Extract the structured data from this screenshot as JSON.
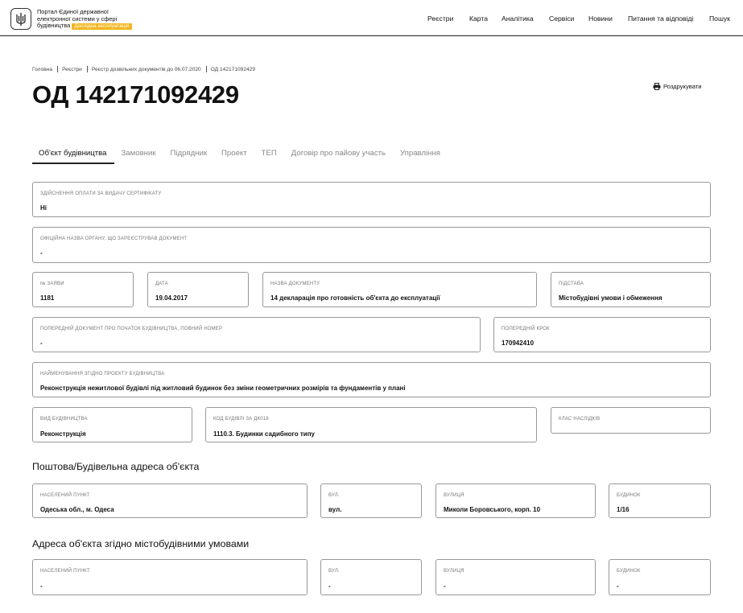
{
  "header": {
    "logo_line1": "Портал Єдиної державної",
    "logo_line2": "електронної системи у сфері",
    "logo_line3": "будівництва",
    "beta_badge": "Дослідна експлуатація",
    "nav": [
      "Реєстри",
      "Карта",
      "Аналітика",
      "Сервіси",
      "Новини",
      "Питання та відповіді",
      "Пошук"
    ]
  },
  "breadcrumbs": [
    "Головна",
    "Реєстри",
    "Реєстр дозвільних документів до 06.07.2020",
    "ОД 142171092429"
  ],
  "page": {
    "title": "ОД 142171092429",
    "print_label": "Роздрукувати"
  },
  "tabs": [
    "Об'єкт будівництва",
    "Замовник",
    "Підрядник",
    "Проект",
    "ТЕП",
    "Договір про пайову участь",
    "Управління"
  ],
  "fields": {
    "payment": {
      "label": "Здійснення оплати за видачу сертифікату",
      "value": "Ні"
    },
    "authority": {
      "label": "Офіційна назва органу, що зареєстрував документ",
      "value": "-"
    },
    "application_no": {
      "label": "№ заяви",
      "value": "1181"
    },
    "date": {
      "label": "Дата",
      "value": "19.04.2017"
    },
    "doc_name": {
      "label": "Назва документу",
      "value": "14 декларація про готовність об'єкта до експлуатації"
    },
    "basis": {
      "label": "Підстава",
      "value": "Містобудівні умови і обмеження"
    },
    "prev_doc": {
      "label": "Попередній документ про початок будівництва, повний номер",
      "value": "-"
    },
    "prev_step": {
      "label": "Попередній крок",
      "value": "170942410"
    },
    "project_name": {
      "label": "Найменування згідно проекту будівництва",
      "value": "Реконструкція нежитлової будівлі під житловий будинок без зміни геометричних розмірів та фундаментів у плані"
    },
    "construction_type": {
      "label": "Вид будівництва",
      "value": "Реконструкція"
    },
    "building_code": {
      "label": "Код будівлі за ДК018",
      "value": "1110.3. Будинки садибного типу"
    },
    "consequence_class": {
      "label": "Клас наслідків",
      "value": ""
    }
  },
  "postal_address": {
    "title": "Поштова/Будівельна адреса об'єкта",
    "settlement": {
      "label": "Населений пункт",
      "value": "Одеська обл., м. Одеса"
    },
    "street_type": {
      "label": "Вул.",
      "value": "вул."
    },
    "street": {
      "label": "Вулиця",
      "value": "Миколи Боровського, корп. 10"
    },
    "house": {
      "label": "Будинок",
      "value": "1/16"
    }
  },
  "planning_address": {
    "title": "Адреса об'єкта згідно містобудівними умовами",
    "settlement": {
      "label": "Населений пункт",
      "value": "-"
    },
    "street_type": {
      "label": "Вул.",
      "value": "-"
    },
    "street": {
      "label": "Вулиця",
      "value": "-"
    },
    "house": {
      "label": "Будинок",
      "value": "-"
    }
  }
}
